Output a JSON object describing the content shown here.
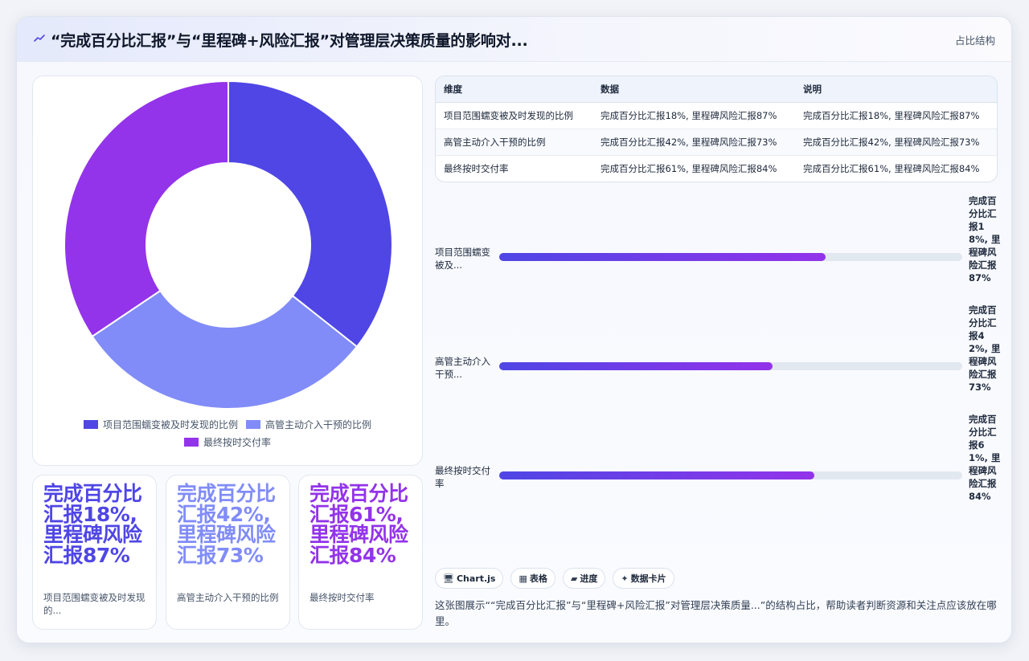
{
  "header": {
    "icon": "trend-line-icon",
    "title": "“完成百分比汇报”与“里程碑+风险汇报”对管理层决策质量的影响对...",
    "badge": "占比结构"
  },
  "chart_data": {
    "type": "pie",
    "categories": [
      "项目范围蠕变被及时发现的比例",
      "高管主动介入干预的比例",
      "最终按时交付率"
    ],
    "values": [
      87,
      73,
      84
    ],
    "colors": [
      "#4f46e5",
      "#818cf8",
      "#9333ea"
    ],
    "hole": "donut",
    "legend_position": "bottom"
  },
  "stats": [
    {
      "value": "完成百分比汇报18%, 里程碑风险汇报87%",
      "label": "项目范围蠕变被及时发现的...",
      "color": "#4f46e5"
    },
    {
      "value": "完成百分比汇报42%, 里程碑风险汇报73%",
      "label": "高管主动介入干预的比例",
      "color": "#818cf8"
    },
    {
      "value": "完成百分比汇报61%, 里程碑风险汇报84%",
      "label": "最终按时交付率",
      "color": "#9333ea"
    }
  ],
  "table": {
    "headers": [
      "维度",
      "数据",
      "说明"
    ],
    "rows": [
      [
        "项目范围蠕变被及时发现的比例",
        "完成百分比汇报18%, 里程碑风险汇报87%",
        "完成百分比汇报18%, 里程碑风险汇报87%"
      ],
      [
        "高管主动介入干预的比例",
        "完成百分比汇报42%, 里程碑风险汇报73%",
        "完成百分比汇报42%, 里程碑风险汇报73%"
      ],
      [
        "最终按时交付率",
        "完成百分比汇报61%, 里程碑风险汇报84%",
        "完成百分比汇报61%, 里程碑风险汇报84%"
      ]
    ]
  },
  "progress": [
    {
      "label": "项目范围蠕变被及...",
      "fraction": 0.705,
      "value": "完成百分比汇报18%, 里程碑风险汇报87%"
    },
    {
      "label": "高管主动介入干预...",
      "fraction": 0.59,
      "value": "完成百分比汇报42%, 里程碑风险汇报73%"
    },
    {
      "label": "最终按时交付率",
      "fraction": 0.68,
      "value": "完成百分比汇报61%, 里程碑风险汇报84%"
    }
  ],
  "chips": [
    {
      "icon": "🖥",
      "label": "Chart.js"
    },
    {
      "icon": "▦",
      "label": "表格"
    },
    {
      "icon": "▰",
      "label": "进度"
    },
    {
      "icon": "✦",
      "label": "数据卡片"
    }
  ],
  "description": "这张图展示““完成百分比汇报”与“里程碑+风险汇报”对管理层决策质量...”的结构占比，帮助读者判断资源和关注点应该放在哪里。"
}
